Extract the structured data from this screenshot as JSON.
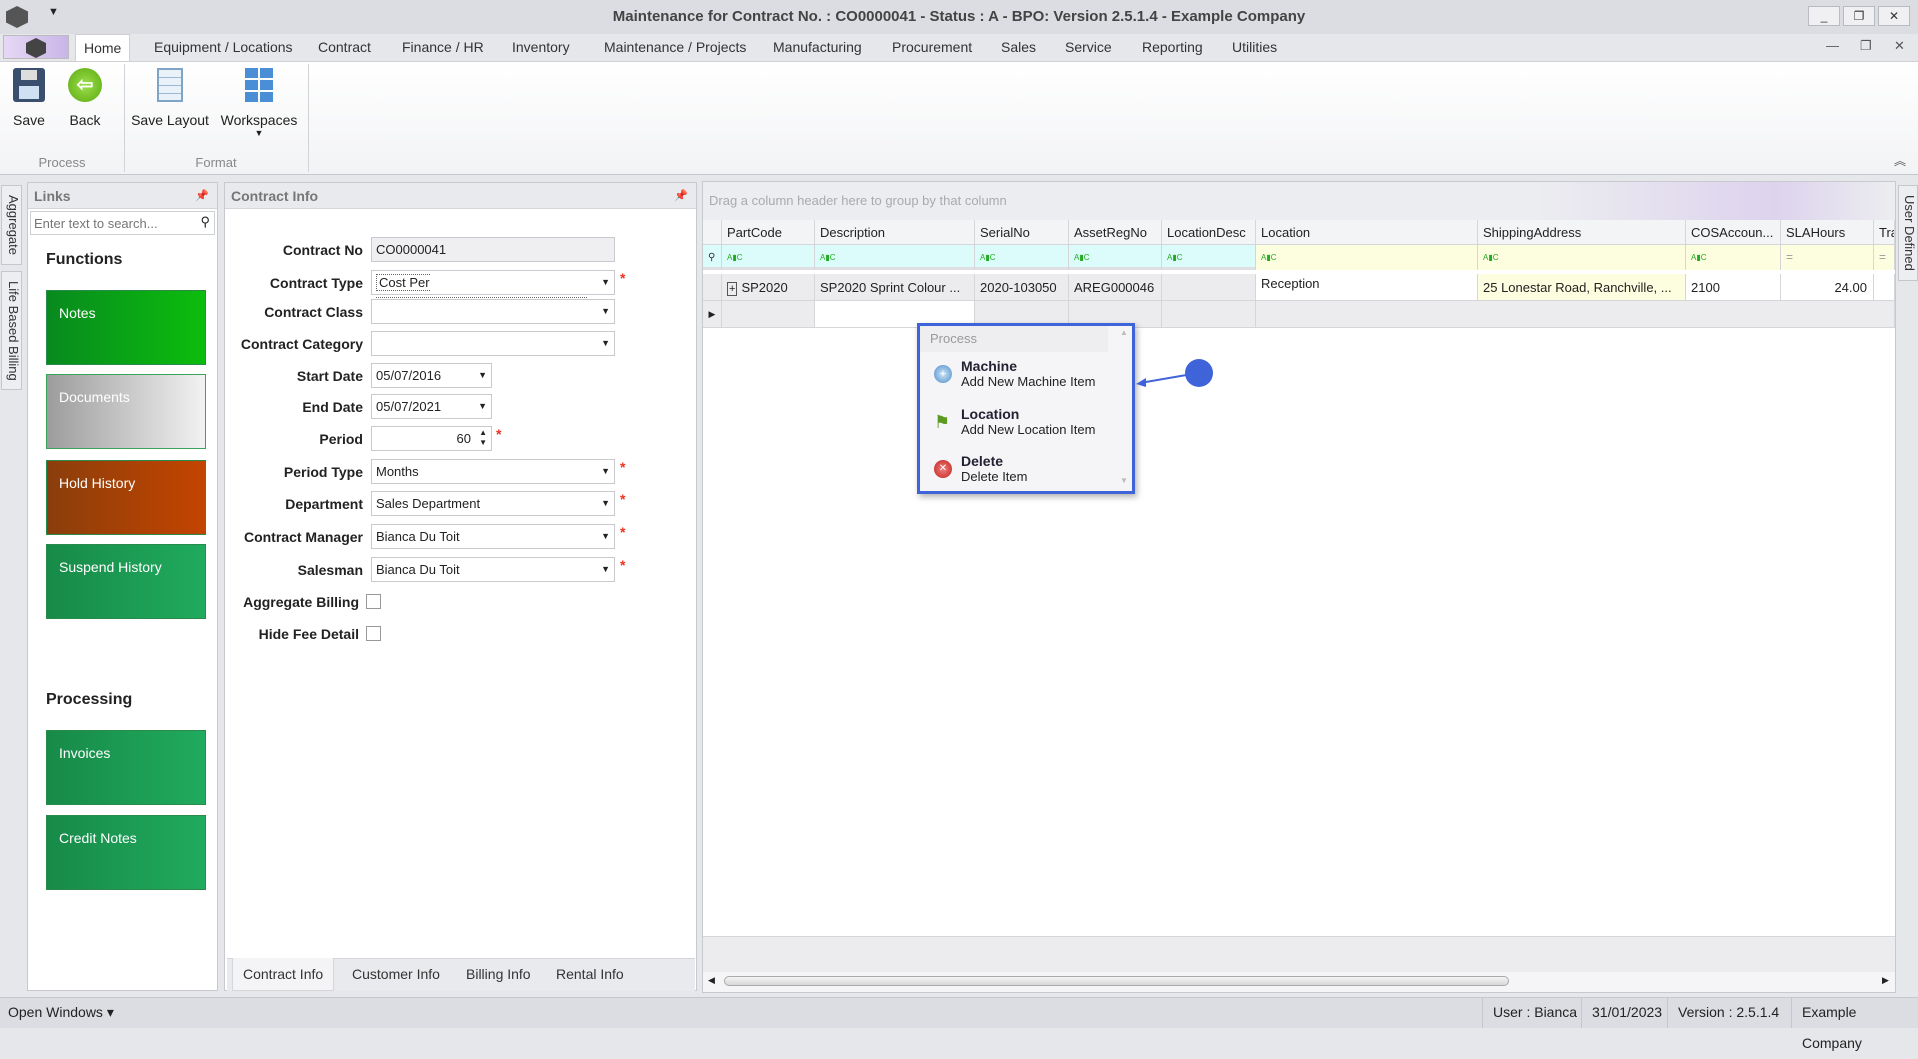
{
  "window": {
    "title": "Maintenance for Contract No. : CO0000041 - Status : A - BPO: Version 2.5.1.4 - Example Company"
  },
  "menu_tabs": [
    "Home",
    "Equipment / Locations",
    "Contract",
    "Finance / HR",
    "Inventory",
    "Maintenance / Projects",
    "Manufacturing",
    "Procurement",
    "Sales",
    "Service",
    "Reporting",
    "Utilities"
  ],
  "ribbon": {
    "save": "Save",
    "back": "Back",
    "save_layout": "Save Layout",
    "workspaces": "Workspaces",
    "group_process": "Process",
    "group_format": "Format"
  },
  "side_tabs": {
    "aggregate": "Aggregate",
    "life_based_billing": "Life Based Billing",
    "user_defined": "User Defined"
  },
  "links": {
    "title": "Links",
    "search_placeholder": "Enter text to search...",
    "functions_heading": "Functions",
    "functions": [
      "Notes",
      "Documents",
      "Hold History",
      "Suspend History"
    ],
    "processing_heading": "Processing",
    "processing": [
      "Invoices",
      "Credit Notes"
    ]
  },
  "contract_info": {
    "title": "Contract Info",
    "fields": {
      "contract_no": {
        "label": "Contract No",
        "value": "CO0000041"
      },
      "contract_type": {
        "label": "Contract Type",
        "value": "Cost Per Copy"
      },
      "contract_class": {
        "label": "Contract Class",
        "value": ""
      },
      "contract_category": {
        "label": "Contract Category",
        "value": ""
      },
      "start_date": {
        "label": "Start Date",
        "value": "05/07/2016"
      },
      "end_date": {
        "label": "End Date",
        "value": "05/07/2021"
      },
      "period": {
        "label": "Period",
        "value": "60"
      },
      "period_type": {
        "label": "Period Type",
        "value": "Months"
      },
      "department": {
        "label": "Department",
        "value": "Sales Department"
      },
      "contract_manager": {
        "label": "Contract Manager",
        "value": "Bianca Du Toit"
      },
      "salesman": {
        "label": "Salesman",
        "value": "Bianca Du Toit"
      },
      "aggregate_billing": {
        "label": "Aggregate Billing",
        "checked": false
      },
      "hide_fee_detail": {
        "label": "Hide Fee Detail",
        "checked": false
      }
    },
    "bottom_tabs": [
      "Contract Info",
      "Customer Info",
      "Billing Info",
      "Rental Info"
    ]
  },
  "grid": {
    "group_hint": "Drag a column header here to group by that column",
    "columns": [
      "PartCode",
      "Description",
      "SerialNo",
      "AssetRegNo",
      "LocationDesc",
      "Location",
      "ShippingAddress",
      "COSAccoun...",
      "SLAHours",
      "Tra"
    ],
    "rows": [
      [
        "SP2020",
        "SP2020 Sprint Colour ...",
        "2020-103050",
        "AREG000046",
        "",
        "Reception",
        "25 Lonestar Road, Ranchville, ...",
        "2100",
        "24.00",
        ""
      ]
    ]
  },
  "popup": {
    "title": "Process",
    "items": [
      {
        "title": "Machine",
        "subtitle": "Add New Machine Item"
      },
      {
        "title": "Location",
        "subtitle": "Add New Location Item"
      },
      {
        "title": "Delete",
        "subtitle": "Delete Item"
      }
    ]
  },
  "status_bar": {
    "open_windows": "Open Windows ▾",
    "user": "User : Bianca",
    "date": "31/01/2023",
    "version": "Version : 2.5.1.4",
    "company": "Example Company"
  },
  "colors": {
    "accent": "#3f63d8",
    "notes": "#0aa81a",
    "hold": "#b8410a",
    "suspend": "#1fa55a"
  }
}
